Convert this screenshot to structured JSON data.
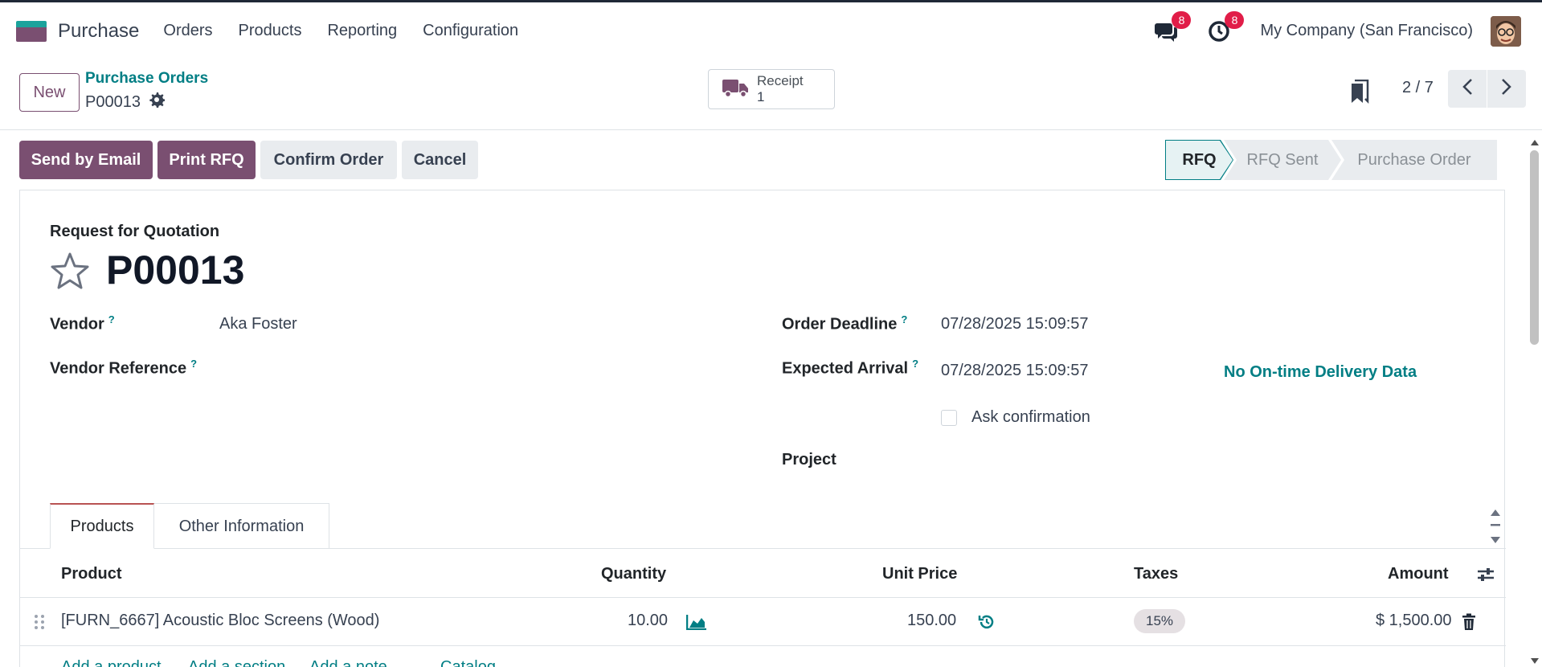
{
  "navbar": {
    "app_name": "Purchase",
    "menus": [
      "Orders",
      "Products",
      "Reporting",
      "Configuration"
    ],
    "messages_count": "8",
    "activities_count": "8",
    "company": "My Company (San Francisco)"
  },
  "control": {
    "new_label": "New",
    "breadcrumb": "Purchase Orders",
    "record": "P00013",
    "receipt_label": "Receipt",
    "receipt_count": "1",
    "pager": "2 / 7"
  },
  "actions": {
    "send_email": "Send by Email",
    "print_rfq": "Print RFQ",
    "confirm": "Confirm Order",
    "cancel": "Cancel"
  },
  "status": {
    "stages": [
      "RFQ",
      "RFQ Sent",
      "Purchase Order"
    ],
    "active_index": 0
  },
  "form": {
    "subtitle": "Request for Quotation",
    "title": "P00013",
    "help_mark": "?",
    "vendor_label": "Vendor",
    "vendor_value": "Aka Foster",
    "vendor_ref_label": "Vendor Reference",
    "order_deadline_label": "Order Deadline",
    "order_deadline_value": "07/28/2025 15:09:57",
    "expected_arrival_label": "Expected Arrival",
    "expected_arrival_value": "07/28/2025 15:09:57",
    "delivery_data": "No On-time Delivery Data",
    "ask_confirmation": "Ask confirmation",
    "project_label": "Project"
  },
  "tabs": [
    "Products",
    "Other Information"
  ],
  "table": {
    "headers": {
      "product": "Product",
      "quantity": "Quantity",
      "unit_price": "Unit Price",
      "taxes": "Taxes",
      "amount": "Amount"
    },
    "rows": [
      {
        "product": "[FURN_6667] Acoustic Bloc Screens (Wood)",
        "quantity": "10.00",
        "unit_price": "150.00",
        "taxes": "15%",
        "amount": "$ 1,500.00"
      }
    ],
    "add_links": [
      "Add a product",
      "Add a section",
      "Add a note",
      "Catalog"
    ]
  },
  "colors": {
    "primary": "#7a4f71",
    "accent": "#017e84",
    "badge": "#e11d48"
  }
}
